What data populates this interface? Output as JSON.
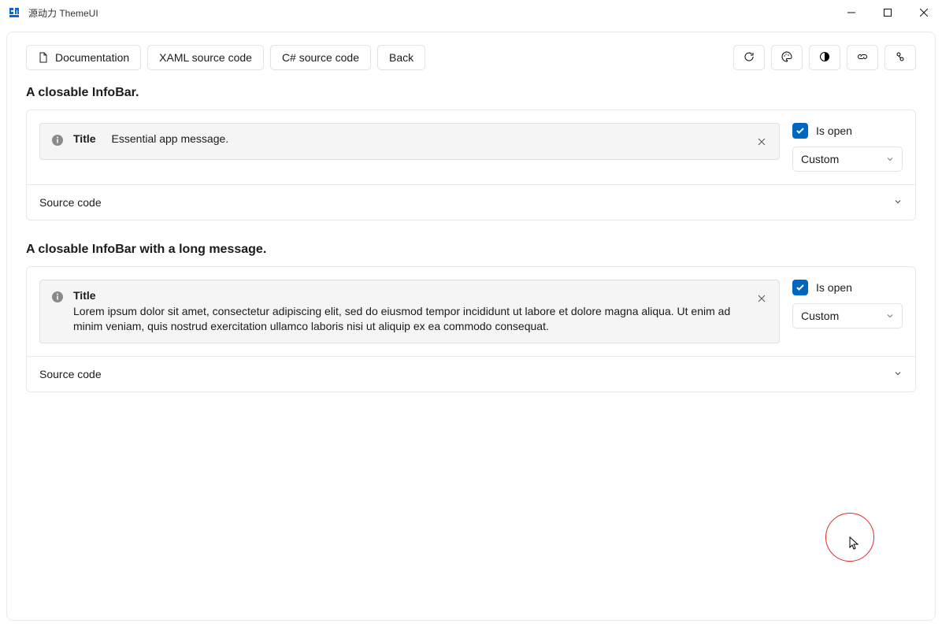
{
  "window": {
    "title": "源动力 ThemeUI"
  },
  "toolbar": {
    "documentation": "Documentation",
    "xaml_source": "XAML source code",
    "csharp_source": "C# source code",
    "back": "Back"
  },
  "sections": [
    {
      "heading": "A closable InfoBar.",
      "infobar": {
        "title": "Title",
        "message": "Essential app message."
      },
      "controls": {
        "is_open_label": "Is open",
        "is_open_checked": true,
        "combo_value": "Custom"
      },
      "source_code_label": "Source code"
    },
    {
      "heading": "A closable InfoBar with a long message.",
      "infobar": {
        "title": "Title",
        "message": "Lorem ipsum dolor sit amet, consectetur adipiscing elit, sed do eiusmod tempor incididunt ut labore et dolore magna aliqua. Ut enim ad minim veniam, quis nostrud exercitation ullamco laboris nisi ut aliquip ex ea commodo consequat."
      },
      "controls": {
        "is_open_label": "Is open",
        "is_open_checked": true,
        "combo_value": "Custom"
      },
      "source_code_label": "Source code"
    }
  ]
}
